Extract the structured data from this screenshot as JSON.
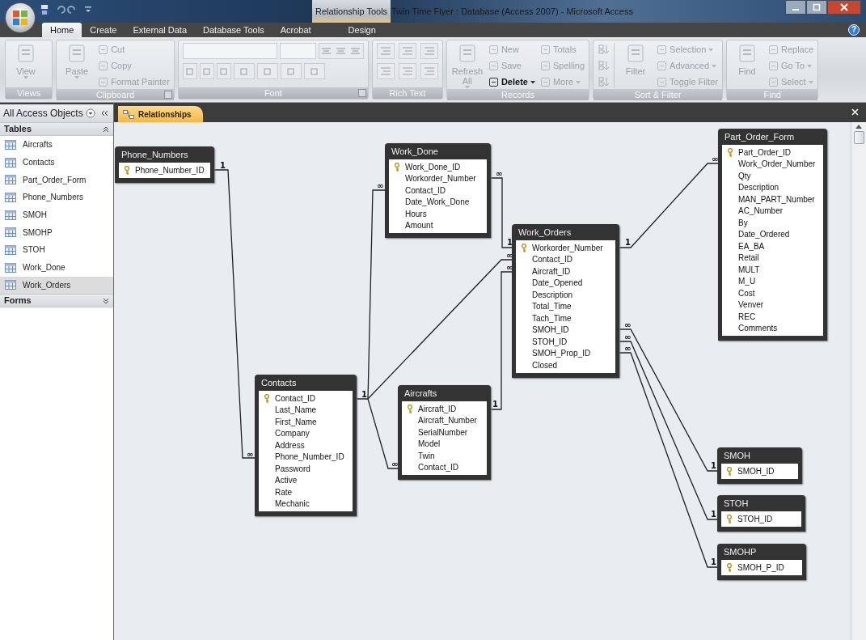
{
  "window": {
    "title": "Twin Time Flyer : Database (Access 2007) - Microsoft Access",
    "context_tab": "Relationship Tools",
    "help_button": "?"
  },
  "ribbon_tabs": [
    {
      "label": "Home",
      "selected": true
    },
    {
      "label": "Create",
      "selected": false
    },
    {
      "label": "External Data",
      "selected": false
    },
    {
      "label": "Database Tools",
      "selected": false
    },
    {
      "label": "Acrobat",
      "selected": false
    },
    {
      "label": "Design",
      "selected": false
    }
  ],
  "ribbon_groups": [
    {
      "label": "Views",
      "columns": [
        {
          "kind": "large",
          "items": [
            {
              "label": "View",
              "disabled": true,
              "dropdown": true
            }
          ]
        }
      ]
    },
    {
      "label": "Clipboard",
      "launcher": true,
      "columns": [
        {
          "kind": "large",
          "items": [
            {
              "label": "Paste",
              "disabled": true,
              "dropdown": true
            }
          ]
        },
        {
          "kind": "stack",
          "items": [
            {
              "label": "Cut",
              "disabled": true
            },
            {
              "label": "Copy",
              "disabled": true
            },
            {
              "label": "Format Painter",
              "disabled": true
            }
          ]
        }
      ]
    },
    {
      "label": "Font",
      "launcher": true,
      "columns": [
        {
          "kind": "font_controls"
        }
      ]
    },
    {
      "label": "Rich Text",
      "columns": [
        {
          "kind": "richtext_controls"
        }
      ]
    },
    {
      "label": "Records",
      "columns": [
        {
          "kind": "large",
          "items": [
            {
              "label": "Refresh All",
              "disabled": true,
              "dropdown": true
            }
          ]
        },
        {
          "kind": "stack",
          "items": [
            {
              "label": "New",
              "disabled": true
            },
            {
              "label": "Save",
              "disabled": true
            },
            {
              "label": "Delete",
              "disabled": false,
              "dropdown": true
            }
          ]
        },
        {
          "kind": "stack",
          "items": [
            {
              "label": "Totals",
              "disabled": true
            },
            {
              "label": "Spelling",
              "disabled": true
            },
            {
              "label": "More",
              "disabled": true,
              "dropdown": true
            }
          ]
        }
      ]
    },
    {
      "label": "Sort & Filter",
      "columns": [
        {
          "kind": "sort_icons"
        },
        {
          "kind": "large",
          "items": [
            {
              "label": "Filter",
              "disabled": true
            }
          ]
        },
        {
          "kind": "stack",
          "items": [
            {
              "label": "Selection",
              "disabled": true,
              "dropdown": true
            },
            {
              "label": "Advanced",
              "disabled": true,
              "dropdown": true
            },
            {
              "label": "Toggle Filter",
              "disabled": true
            }
          ]
        }
      ]
    },
    {
      "label": "Find",
      "columns": [
        {
          "kind": "large",
          "items": [
            {
              "label": "Find",
              "disabled": true
            }
          ]
        },
        {
          "kind": "stack",
          "items": [
            {
              "label": "Replace",
              "disabled": true
            },
            {
              "label": "Go To",
              "disabled": true,
              "dropdown": true
            },
            {
              "label": "Select",
              "disabled": true,
              "dropdown": true
            }
          ]
        }
      ]
    }
  ],
  "nav_pane": {
    "title": "All Access Objects",
    "groups": [
      {
        "title": "Tables",
        "expanded": true,
        "items": [
          {
            "label": "Aircrafts",
            "selected": false
          },
          {
            "label": "Contacts",
            "selected": false
          },
          {
            "label": "Part_Order_Form",
            "selected": false
          },
          {
            "label": "Phone_Numbers",
            "selected": false
          },
          {
            "label": "SMOH",
            "selected": false
          },
          {
            "label": "SMOHP",
            "selected": false
          },
          {
            "label": "STOH",
            "selected": false
          },
          {
            "label": "Work_Done",
            "selected": false
          },
          {
            "label": "Work_Orders",
            "selected": true
          }
        ]
      },
      {
        "title": "Forms",
        "expanded": false
      }
    ]
  },
  "document_tab": {
    "label": "Relationships"
  },
  "tables": [
    {
      "name": "Phone_Numbers",
      "fields": [
        {
          "name": "Phone_Number_ID",
          "key": true
        }
      ]
    },
    {
      "name": "Work_Done",
      "fields": [
        {
          "name": "Work_Done_ID",
          "key": true
        },
        {
          "name": "Workorder_Number",
          "key": false
        },
        {
          "name": "Contact_ID",
          "key": false
        },
        {
          "name": "Date_Work_Done",
          "key": false
        },
        {
          "name": "Hours",
          "key": false
        },
        {
          "name": "Amount",
          "key": false
        }
      ]
    },
    {
      "name": "Work_Orders",
      "fields": [
        {
          "name": "Workorder_Number",
          "key": true
        },
        {
          "name": "Contact_ID",
          "key": false
        },
        {
          "name": "Aircraft_ID",
          "key": false
        },
        {
          "name": "Date_Opened",
          "key": false
        },
        {
          "name": "Description",
          "key": false
        },
        {
          "name": "Total_Time",
          "key": false
        },
        {
          "name": "Tach_Time",
          "key": false
        },
        {
          "name": "SMOH_ID",
          "key": false
        },
        {
          "name": "STOH_ID",
          "key": false
        },
        {
          "name": "SMOH_Prop_ID",
          "key": false
        },
        {
          "name": "Closed",
          "key": false
        }
      ]
    },
    {
      "name": "Part_Order_Form",
      "fields": [
        {
          "name": "Part_Order_ID",
          "key": true
        },
        {
          "name": "Work_Order_Number",
          "key": false
        },
        {
          "name": "Qty",
          "key": false
        },
        {
          "name": "Description",
          "key": false
        },
        {
          "name": "MAN_PART_Number",
          "key": false
        },
        {
          "name": "AC_Number",
          "key": false
        },
        {
          "name": "By",
          "key": false
        },
        {
          "name": "Date_Ordered",
          "key": false
        },
        {
          "name": "EA_BA",
          "key": false
        },
        {
          "name": "Retail",
          "key": false
        },
        {
          "name": "MULT",
          "key": false
        },
        {
          "name": "M_U",
          "key": false
        },
        {
          "name": "Cost",
          "key": false
        },
        {
          "name": "Venver",
          "key": false
        },
        {
          "name": "REC",
          "key": false
        },
        {
          "name": "Comments",
          "key": false
        }
      ]
    },
    {
      "name": "Contacts",
      "fields": [
        {
          "name": "Contact_ID",
          "key": true
        },
        {
          "name": "Last_Name",
          "key": false
        },
        {
          "name": "First_Name",
          "key": false
        },
        {
          "name": "Company",
          "key": false
        },
        {
          "name": "Address",
          "key": false
        },
        {
          "name": "Phone_Number_ID",
          "key": false
        },
        {
          "name": "Password",
          "key": false
        },
        {
          "name": "Active",
          "key": false
        },
        {
          "name": "Rate",
          "key": false
        },
        {
          "name": "Mechanic",
          "key": false
        }
      ]
    },
    {
      "name": "Aircrafts",
      "fields": [
        {
          "name": "Aircraft_ID",
          "key": true
        },
        {
          "name": "Aircraft_Number",
          "key": false
        },
        {
          "name": "SerialNumber",
          "key": false
        },
        {
          "name": "Model",
          "key": false
        },
        {
          "name": "Twin",
          "key": false
        },
        {
          "name": "Contact_ID",
          "key": false
        }
      ]
    },
    {
      "name": "SMOH",
      "fields": [
        {
          "name": "SMOH_ID",
          "key": true
        }
      ]
    },
    {
      "name": "STOH",
      "fields": [
        {
          "name": "STOH_ID",
          "key": true
        }
      ]
    },
    {
      "name": "SMOHP",
      "fields": [
        {
          "name": "SMOH_P_ID",
          "key": true
        }
      ]
    }
  ],
  "relationships": [
    {
      "labels": [
        "1",
        "∞"
      ]
    },
    {
      "labels": [
        "∞",
        "1"
      ]
    },
    {
      "labels": [
        "1",
        "∞"
      ]
    },
    {
      "labels": [
        "∞"
      ]
    },
    {
      "labels": [
        "∞"
      ]
    },
    {
      "labels": [
        "1",
        "∞"
      ]
    },
    {
      "labels": [
        "1",
        "∞"
      ]
    },
    {
      "labels": [
        "∞",
        "1"
      ]
    },
    {
      "labels": [
        "∞",
        "1"
      ]
    },
    {
      "labels": [
        "∞",
        "1"
      ]
    }
  ]
}
